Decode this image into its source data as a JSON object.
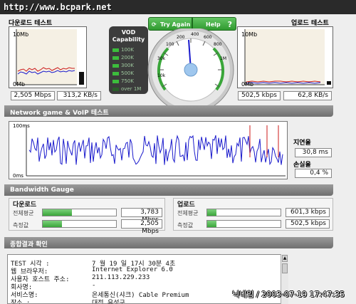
{
  "watermark_url": "http://www.bcpark.net",
  "download": {
    "title": "다운로드 테스트",
    "axis_top": "10Mb",
    "axis_bottom": "0Mb",
    "speed": "2,505 Mbps",
    "rate": "313,2 KB/s"
  },
  "upload": {
    "title": "업로드 테스트",
    "axis_top": "10Mb",
    "axis_bottom": "0Mb",
    "speed": "502,5 kbps",
    "rate": "62,8 KB/s"
  },
  "vod": {
    "title_line1": "VOD",
    "title_line2": "Capability",
    "levels": [
      "100K",
      "200K",
      "300K",
      "500K",
      "750K",
      "over 1M"
    ]
  },
  "buttons": {
    "try_again": "Try Again",
    "help": "Help",
    "help_icon": "?"
  },
  "dial": {
    "labels": [
      "10k",
      "30k",
      "100",
      "200",
      "400",
      "600",
      "800",
      "1M"
    ]
  },
  "network": {
    "title": "Network game & VoIP 테스트",
    "axis_top": "100ms",
    "axis_bottom": "0ms",
    "latency_label": "지연율",
    "latency_value": "30,8 ms",
    "loss_label": "손실율",
    "loss_value": "0,4 %"
  },
  "bandwidth": {
    "title": "Bandwidth Gauge",
    "down_label": "다운로드",
    "up_label": "업로드",
    "avg_label": "전체평균",
    "meas_label": "측정값",
    "down_avg": "3,783 Mbps",
    "down_meas": "2,505 Mbps",
    "up_avg": "601,3 kbps",
    "up_meas": "502,5 kbps",
    "down_avg_fill": 0.4,
    "down_meas_fill": 0.26,
    "up_avg_fill": 0.13,
    "up_meas_fill": 0.13
  },
  "summary": {
    "title": "종합결과 확인",
    "rows": [
      {
        "key": "TEST 시각 :",
        "value": "7 월 19 일   17시 30분 4초"
      },
      {
        "key": "웹 브라우저:",
        "value": "Internet Explorer 6.0"
      },
      {
        "key": "사용자 호스트 주소:",
        "value": "211.113.229.233"
      },
      {
        "key": "회사명:",
        "value": "-"
      },
      {
        "key": "서비스명:",
        "value": "온세통신(샤크) Cable Premium"
      },
      {
        "key": "장소 :",
        "value": "대전 유성구"
      }
    ]
  },
  "photo_watermark": "닉네임 / 2003-07-19 17:47:35",
  "colors": {
    "accent_green": "#3aa63a",
    "line_blue": "#1a1acc",
    "line_red": "#cc1a1a",
    "section_grey": "#808080"
  }
}
